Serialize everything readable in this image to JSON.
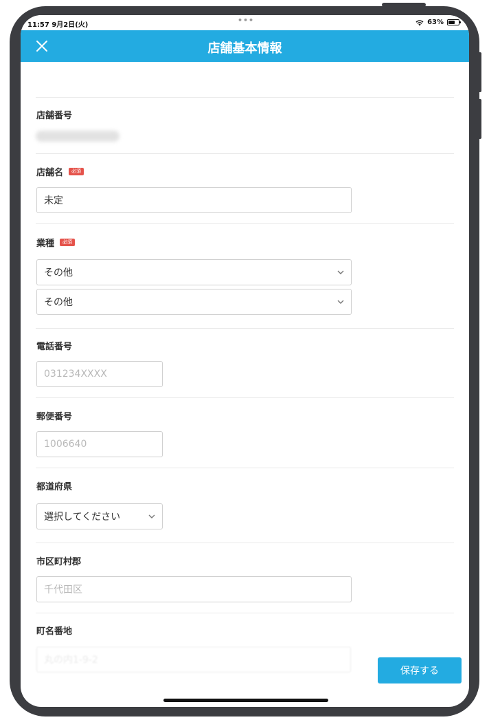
{
  "status_bar": {
    "time": "11:57  9月2日(火)",
    "dots": "•••",
    "battery": "63%",
    "battery_level": 0.63
  },
  "header": {
    "title": "店舗基本情報",
    "close_icon": "close-icon"
  },
  "form": {
    "store_number": {
      "label": "店舗番号"
    },
    "store_name": {
      "label": "店舗名",
      "required_badge": "必須",
      "value": "未定"
    },
    "business_type": {
      "label": "業種",
      "required_badge": "必須",
      "select1": "その他",
      "select2": "その他"
    },
    "phone": {
      "label": "電話番号",
      "placeholder": "031234XXXX"
    },
    "postal_code": {
      "label": "郵便番号",
      "placeholder": "1006640"
    },
    "prefecture": {
      "label": "都道府県",
      "select": "選択してください"
    },
    "city": {
      "label": "市区町村郡",
      "placeholder": "千代田区"
    },
    "address": {
      "label": "町名番地",
      "placeholder": "丸の内1-9-2"
    }
  },
  "actions": {
    "save_label": "保存する"
  },
  "colors": {
    "brand": "#23abe1",
    "required": "#e5534b",
    "frame": "#3c3d41"
  }
}
